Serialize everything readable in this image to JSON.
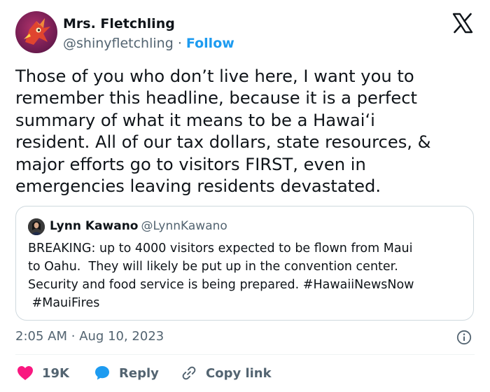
{
  "author": {
    "name": "Mrs. Fletchling",
    "handle": "@shinyfletchling",
    "separator": "·",
    "follow_label": "Follow"
  },
  "tweet": {
    "lines": [
      "Those of you who don’t live here, I want you to",
      "remember this headline, because it is a perfect",
      "summary of what it means to be a Hawaiʻi",
      "resident. All of our tax dollars, state resources, &",
      "major efforts go to visitors FIRST, even in",
      "emergencies leaving residents devastated."
    ]
  },
  "quoted": {
    "name": "Lynn Kawano",
    "handle": "@LynnKawano",
    "lines": [
      "BREAKING: up to 4000 visitors expected to be flown from Maui",
      "to Oahu.  They will likely be put up in the convention center.",
      "Security and food service is being prepared. #HawaiiNewsNow",
      " #MauiFires"
    ]
  },
  "meta": {
    "time": "2:05 AM",
    "separator": "·",
    "date": "Aug 10, 2023"
  },
  "actions": {
    "like_count": "19K",
    "reply_label": "Reply",
    "copy_label": "Copy link"
  },
  "colors": {
    "like": "#f91880",
    "reply": "#1d9bf0",
    "follow": "#1d9bf0",
    "secondary_text": "#536471"
  },
  "icons": [
    "x-logo-icon",
    "info-icon",
    "heart-icon",
    "reply-bubble-icon",
    "link-icon"
  ]
}
